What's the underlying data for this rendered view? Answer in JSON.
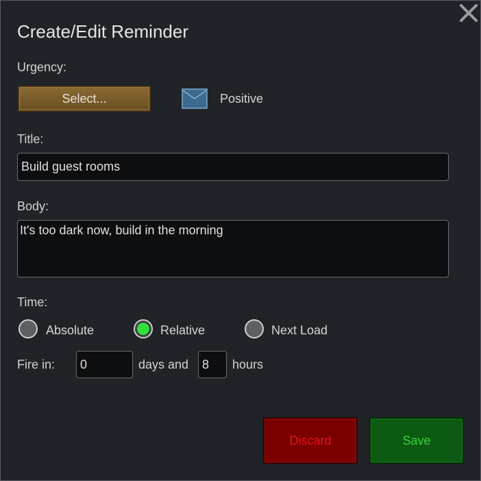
{
  "dialog": {
    "title": "Create/Edit Reminder",
    "close_icon": "close-icon"
  },
  "urgency": {
    "label": "Urgency:",
    "select_label": "Select...",
    "icon": "envelope-icon",
    "value": "Positive"
  },
  "title_field": {
    "label": "Title:",
    "value": "Build guest rooms"
  },
  "body_field": {
    "label": "Body:",
    "value": "It's too dark now, build in the morning"
  },
  "time": {
    "label": "Time:",
    "options": [
      {
        "label": "Absolute",
        "checked": false
      },
      {
        "label": "Relative",
        "checked": true
      },
      {
        "label": "Next Load",
        "checked": false
      }
    ],
    "fire_in_label": "Fire in:",
    "days_value": "0",
    "days_label": "days and",
    "hours_value": "8",
    "hours_label": "hours"
  },
  "buttons": {
    "discard": "Discard",
    "save": "Save"
  },
  "colors": {
    "background": "#202327",
    "select_button": "#7a5c2b",
    "discard_bg": "#7a0000",
    "discard_text": "#e0161a",
    "save_bg": "#0c5a12",
    "save_text": "#36d43c",
    "radio_checked": "#2ee03a"
  }
}
